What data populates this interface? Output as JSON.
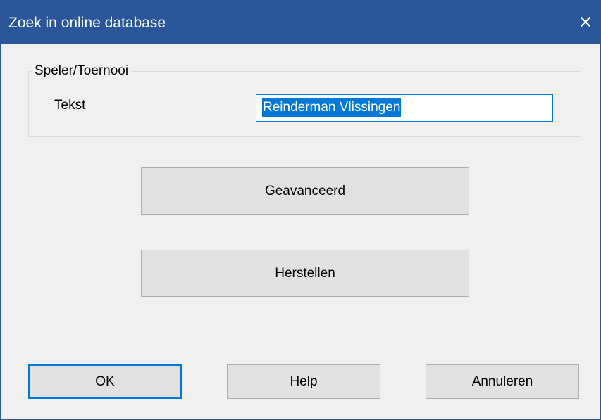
{
  "window": {
    "title": "Zoek in online database"
  },
  "group": {
    "label": "Speler/Toernooi",
    "field_label": "Tekst",
    "field_value": "Reinderman Vlissingen"
  },
  "buttons": {
    "advanced": "Geavanceerd",
    "reset": "Herstellen",
    "ok": "OK",
    "help": "Help",
    "cancel": "Annuleren"
  },
  "icons": {
    "close": "close-icon"
  },
  "colors": {
    "titlebar": "#2b579a",
    "accent": "#0078d7",
    "dialog_bg": "#f0f0f0",
    "button_bg": "#e1e1e1"
  }
}
